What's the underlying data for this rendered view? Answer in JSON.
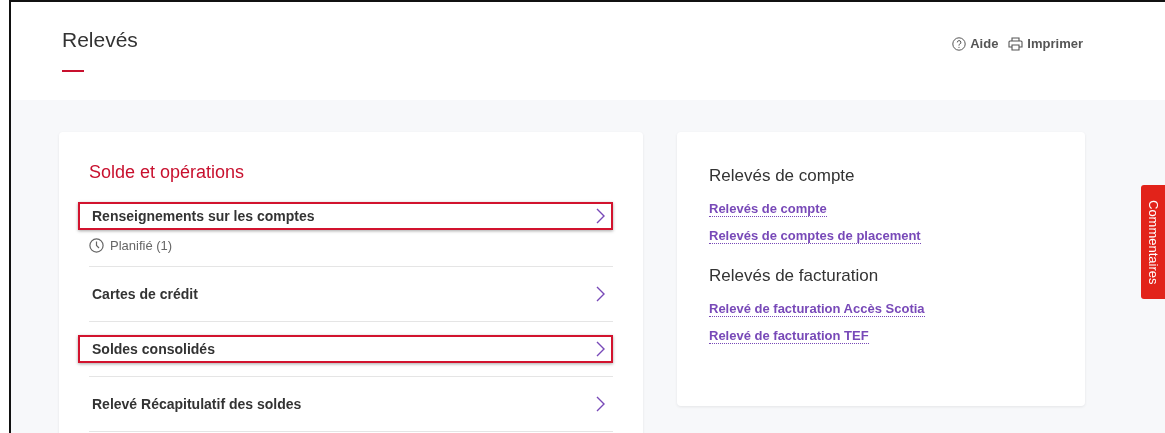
{
  "page": {
    "title": "Relevés",
    "actions": [
      {
        "kind": "help",
        "label": "Aide"
      },
      {
        "kind": "print",
        "label": "Imprimer"
      }
    ]
  },
  "balance_card": {
    "title": "Solde et opérations",
    "items": [
      {
        "label": "Renseignements sur les comptes",
        "highlighted": true,
        "note": "Planifié (1)"
      },
      {
        "label": "Cartes de crédit",
        "highlighted": false
      },
      {
        "label": "Soldes consolidés",
        "highlighted": true
      },
      {
        "label": "Relevé Récapitulatif des soldes",
        "highlighted": false
      }
    ]
  },
  "statements_card": {
    "sections": [
      {
        "title": "Relevés de compte",
        "links": [
          "Relevés de compte",
          "Relevés de comptes de placement"
        ]
      },
      {
        "title": "Relevés de facturation",
        "links": [
          "Relevé de facturation Accès Scotia",
          "Relevé de facturation TEF"
        ]
      }
    ]
  },
  "feedback_tab": {
    "label": "Commentaires"
  }
}
